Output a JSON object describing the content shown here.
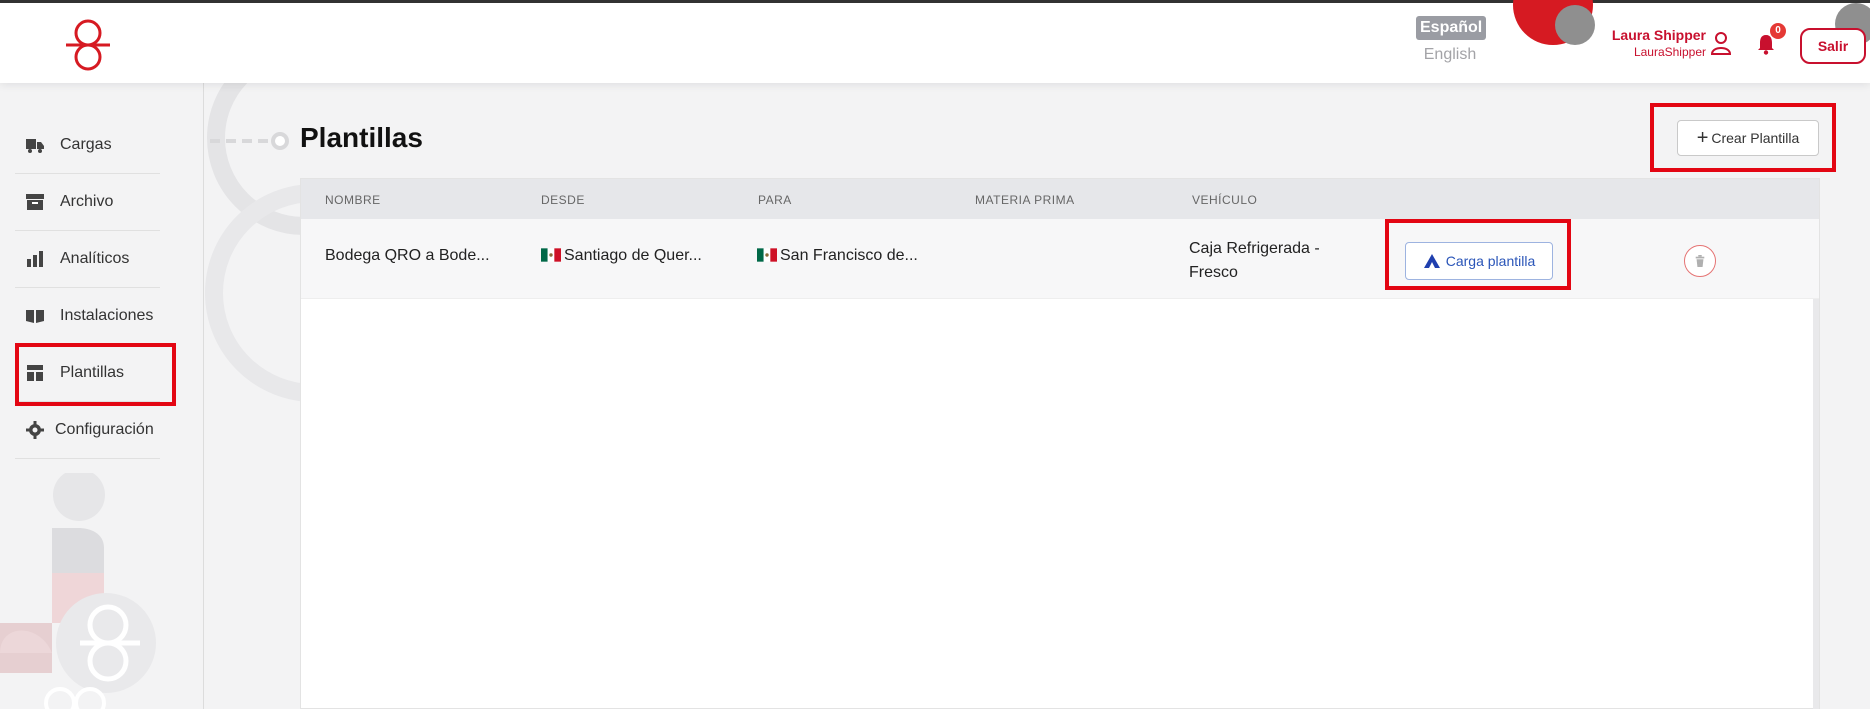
{
  "header": {
    "lang_active": "Español",
    "lang_other": "English",
    "user_name": "Laura Shipper",
    "user_handle": "LauraShipper",
    "notifications_count": "0",
    "logout_label": "Salir"
  },
  "sidebar": {
    "items": [
      {
        "label": "Cargas",
        "icon": "truck-icon"
      },
      {
        "label": "Archivo",
        "icon": "archive-icon"
      },
      {
        "label": "Analíticos",
        "icon": "bar-chart-icon"
      },
      {
        "label": "Instalaciones",
        "icon": "book-icon"
      },
      {
        "label": "Plantillas",
        "icon": "template-icon"
      },
      {
        "label": "Configuración",
        "icon": "gear-icon"
      }
    ]
  },
  "main": {
    "title": "Plantillas",
    "create_label": "Crear Plantilla",
    "columns": [
      "NOMBRE",
      "DESDE",
      "PARA",
      "MATERIA PRIMA",
      "VEHÍCULO"
    ],
    "rows": [
      {
        "nombre": "Bodega QRO a Bode...",
        "desde": "Santiago de Quer...",
        "para": "San Francisco de...",
        "materia_prima": "",
        "vehiculo_line1": "Caja Refrigerada -",
        "vehiculo_line2": "Fresco",
        "action_label": "Carga plantilla"
      }
    ]
  },
  "colors": {
    "brand_red": "#c8102e",
    "highlight_red": "#e30613",
    "link_blue": "#2a55b8"
  }
}
